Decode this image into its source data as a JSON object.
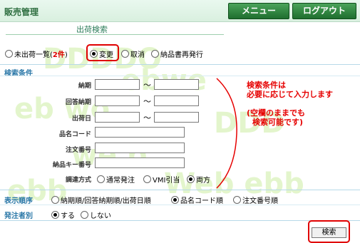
{
  "header": {
    "app_title": "販売管理",
    "menu_button": "メニュー",
    "logout_button": "ログアウト"
  },
  "page": {
    "title": "出荷検索"
  },
  "mode_options": {
    "unshipped_list": "未出荷一覧(",
    "unshipped_count": "2件",
    "close_paren": ")",
    "change": "変更",
    "cancel": "取消",
    "reissue": "納品書再発行",
    "selected": "change"
  },
  "search_conditions": {
    "header": "検索条件",
    "fields": {
      "delivery_date": "納期",
      "answer_delivery_date": "回答納期",
      "ship_date": "出荷日",
      "product_code": "品名コード",
      "order_number": "注文番号",
      "product_key_number": "納品キー番号",
      "procurement_method": "調達方式"
    },
    "range_separator": "〜",
    "procurement_options": [
      "通常発注",
      "VMI引当",
      "両方"
    ],
    "procurement_selected": "両方"
  },
  "annotation": {
    "line1": "検索条件は",
    "line2": "必要に応じて入力します",
    "line3": "(空欄のままでも",
    "line4": "検索可能です)"
  },
  "display_order": {
    "label": "表示順序",
    "options": [
      "納期順/回答納期順/出荷日順",
      "品名コード順",
      "注文番号順"
    ],
    "selected": "品名コード順"
  },
  "orderer_type": {
    "label": "発注者別",
    "options": [
      "する",
      "しない"
    ],
    "selected": "する"
  },
  "search_button": "検索",
  "colors": {
    "annotation_red": "#e60000",
    "header_green": "#2f6f41",
    "section_blue": "#2b78a8"
  }
}
